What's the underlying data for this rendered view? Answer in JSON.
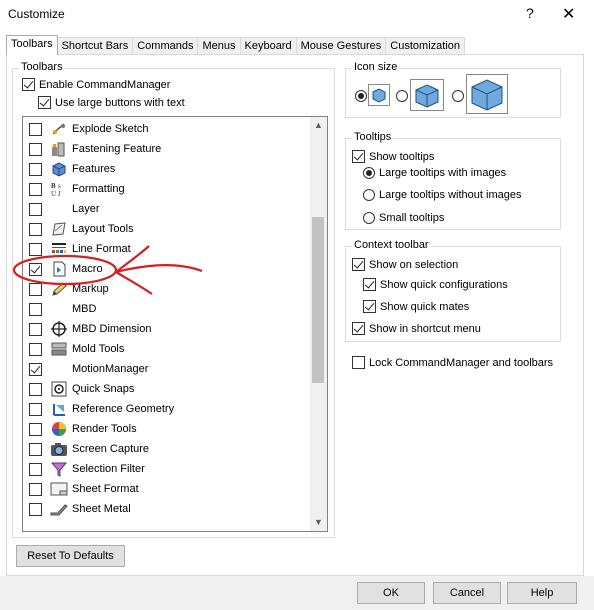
{
  "window": {
    "title": "Customize",
    "help_glyph": "?",
    "close_glyph": "✕"
  },
  "tabs": [
    {
      "label": "Toolbars",
      "active": true
    },
    {
      "label": "Shortcut Bars"
    },
    {
      "label": "Commands"
    },
    {
      "label": "Menus"
    },
    {
      "label": "Keyboard"
    },
    {
      "label": "Mouse Gestures"
    },
    {
      "label": "Customization"
    }
  ],
  "toolbars_group": {
    "legend": "Toolbars",
    "enable_commandmanager": {
      "label": "Enable CommandManager",
      "checked": true
    },
    "large_buttons": {
      "label": "Use large buttons with text",
      "checked": true
    }
  },
  "toolbar_list": {
    "items": [
      {
        "label": "Explode Sketch",
        "checked": false,
        "icon": "explode-sketch-icon"
      },
      {
        "label": "Fastening Feature",
        "checked": false,
        "icon": "fastening-feature-icon"
      },
      {
        "label": "Features",
        "checked": false,
        "icon": "features-icon"
      },
      {
        "label": "Formatting",
        "checked": false,
        "icon": "formatting-icon"
      },
      {
        "label": "Layer",
        "checked": false,
        "icon": ""
      },
      {
        "label": "Layout Tools",
        "checked": false,
        "icon": "layout-tools-icon"
      },
      {
        "label": "Line Format",
        "checked": false,
        "icon": "line-format-icon"
      },
      {
        "label": "Macro",
        "checked": true,
        "icon": "macro-icon"
      },
      {
        "label": "Markup",
        "checked": false,
        "icon": "markup-icon"
      },
      {
        "label": "MBD",
        "checked": false,
        "icon": ""
      },
      {
        "label": "MBD Dimension",
        "checked": false,
        "icon": "mbd-dimension-icon"
      },
      {
        "label": "Mold Tools",
        "checked": false,
        "icon": "mold-tools-icon"
      },
      {
        "label": "MotionManager",
        "checked": true,
        "icon": ""
      },
      {
        "label": "Quick Snaps",
        "checked": false,
        "icon": "quick-snaps-icon"
      },
      {
        "label": "Reference Geometry",
        "checked": false,
        "icon": "reference-geometry-icon"
      },
      {
        "label": "Render Tools",
        "checked": false,
        "icon": "render-tools-icon"
      },
      {
        "label": "Screen Capture",
        "checked": false,
        "icon": "screen-capture-icon"
      },
      {
        "label": "Selection Filter",
        "checked": false,
        "icon": "selection-filter-icon"
      },
      {
        "label": "Sheet Format",
        "checked": false,
        "icon": "sheet-format-icon"
      },
      {
        "label": "Sheet Metal",
        "checked": false,
        "icon": "sheet-metal-icon"
      }
    ],
    "scroll_up_glyph": "▲",
    "scroll_down_glyph": "▼"
  },
  "icon_size": {
    "legend": "Icon size",
    "options": [
      "small",
      "medium",
      "large"
    ],
    "selected": "small"
  },
  "tooltips": {
    "legend": "Tooltips",
    "show_tooltips": {
      "label": "Show tooltips",
      "checked": true
    },
    "options": [
      {
        "label": "Large tooltips with images",
        "selected": true
      },
      {
        "label": "Large tooltips without images",
        "selected": false
      },
      {
        "label": "Small tooltips",
        "selected": false
      }
    ]
  },
  "context_toolbar": {
    "legend": "Context toolbar",
    "show_on_selection": {
      "label": "Show on selection",
      "checked": true
    },
    "show_quick_configurations": {
      "label": "Show quick configurations",
      "checked": true
    },
    "show_quick_mates": {
      "label": "Show quick mates",
      "checked": true
    },
    "show_in_shortcut_menu": {
      "label": "Show in shortcut menu",
      "checked": true
    }
  },
  "lock": {
    "label": "Lock CommandManager and toolbars",
    "checked": false
  },
  "buttons": {
    "reset": "Reset To Defaults",
    "ok": "OK",
    "cancel": "Cancel",
    "help": "Help"
  },
  "annotation": {
    "color": "#d42020"
  }
}
